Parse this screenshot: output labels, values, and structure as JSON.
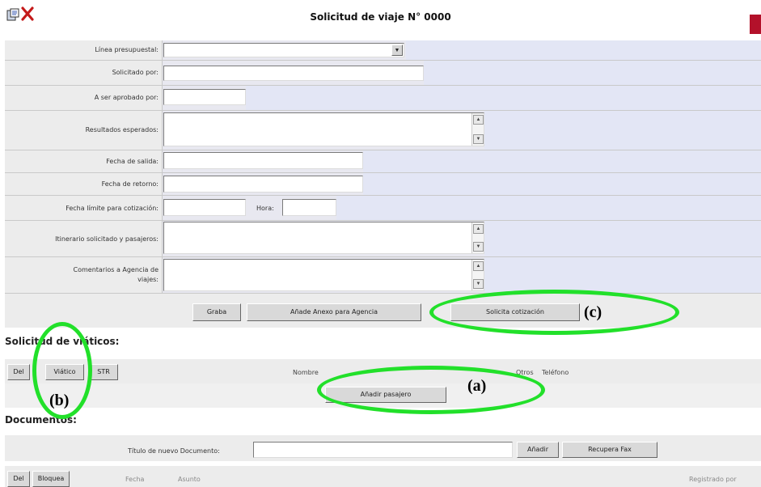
{
  "window": {
    "title": "Solicitud de viaje N° 0000",
    "icons": [
      "document-icon",
      "close-x-icon"
    ]
  },
  "form": {
    "linea_presupuestal": {
      "label": "Línea presupuestal:",
      "value": ""
    },
    "solicitado_por": {
      "label": "Solicitado por:",
      "value": ""
    },
    "aprobado_por": {
      "label": "A ser aprobado por:",
      "value": ""
    },
    "resultados": {
      "label": "Resultados esperados:",
      "value": ""
    },
    "fecha_salida": {
      "label": "Fecha de salida:",
      "value": ""
    },
    "fecha_retorno": {
      "label": "Fecha de retorno:",
      "value": ""
    },
    "fecha_limite": {
      "label": "Fecha límite para cotización:",
      "value": ""
    },
    "hora": {
      "label": "Hora:",
      "value": ""
    },
    "itinerario": {
      "label": "Itinerario solicitado y pasajeros:",
      "value": ""
    },
    "comentarios": {
      "label_line1": "Comentarios a Agencia de",
      "label_line2": "viajes:",
      "value": ""
    }
  },
  "actions": {
    "graba": "Graba",
    "anexo": "Añade Anexo para Agencia",
    "cotizacion": "Solicita cotización"
  },
  "viaticos": {
    "title": "Solicitud de viáticos:",
    "buttons": {
      "del": "Del",
      "viatico": "Viático",
      "str": "STR"
    },
    "columns": {
      "nombre": "Nombre",
      "otros": "Otros",
      "telefono": "Teléfono"
    },
    "add_passenger": "Añadir pasajero"
  },
  "documentos": {
    "title": "Documentos:",
    "new_doc_label": "Título de nuevo Documento:",
    "new_doc_value": "",
    "add": "Añadir",
    "fax": "Recupera Fax",
    "buttons": {
      "del": "Del",
      "bloquea": "Bloquea"
    },
    "columns": {
      "fecha": "Fecha",
      "asunto": "Asunto",
      "registrado": "Registrado por"
    }
  },
  "annotations": {
    "a": "(a)",
    "b": "(b)",
    "c": "(c)"
  },
  "colors": {
    "highlight": "#22e02a",
    "accent_red": "#b3112a",
    "row_fill": "#e3e6f5"
  }
}
